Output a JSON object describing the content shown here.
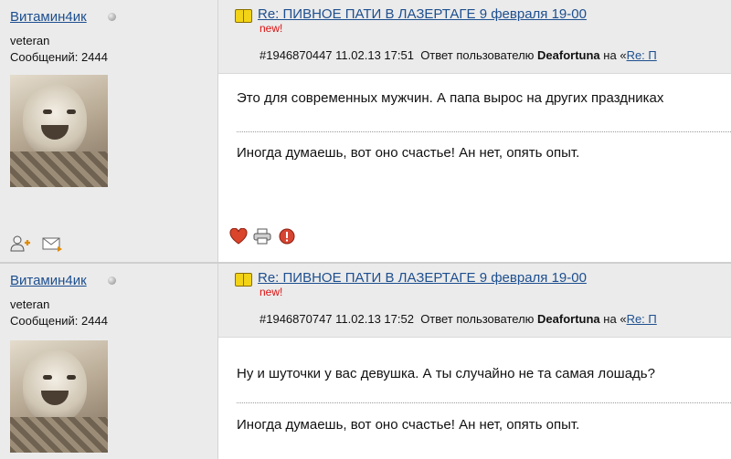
{
  "posts": [
    {
      "author": {
        "name": "Витамин4ик",
        "rank": "veteran",
        "messages": "Сообщений: 2444"
      },
      "title": "Re: ПИВНОЕ ПАТИ В ЛАЗЕРТАГЕ 9 февраля 19-00",
      "new_label": "new!",
      "meta": {
        "id": "#1946870447",
        "datetime": "11.02.13 17:51",
        "reply_text": "Ответ пользователю",
        "reply_user": "Deafortuna",
        "on_text": "на «",
        "reply_link": "Re: П"
      },
      "text": "Это для современных мужчин. А папа вырос на других праздниках",
      "signature": "Иногда думаешь, вот оно счастье! Ан нет, опять опыт."
    },
    {
      "author": {
        "name": "Витамин4ик",
        "rank": "veteran",
        "messages": "Сообщений: 2444"
      },
      "title": "Re: ПИВНОЕ ПАТИ В ЛАЗЕРТАГЕ 9 февраля 19-00",
      "new_label": "new!",
      "meta": {
        "id": "#1946870747",
        "datetime": "11.02.13 17:52",
        "reply_text": "Ответ пользователю",
        "reply_user": "Deafortuna",
        "on_text": "на «",
        "reply_link": "Re: П"
      },
      "text": "Ну и шуточки у вас девушка. А ты случайно не та самая лошадь?",
      "signature": "Иногда думаешь, вот оно счастье! Ан нет, опять опыт."
    }
  ],
  "icons": {
    "add_friend": "add-friend-icon",
    "message": "message-icon",
    "like": "heart-icon",
    "print": "print-icon",
    "report": "report-icon"
  },
  "colors": {
    "link": "#1d4f8f",
    "new": "#dd1111",
    "panel": "#ebebeb"
  }
}
